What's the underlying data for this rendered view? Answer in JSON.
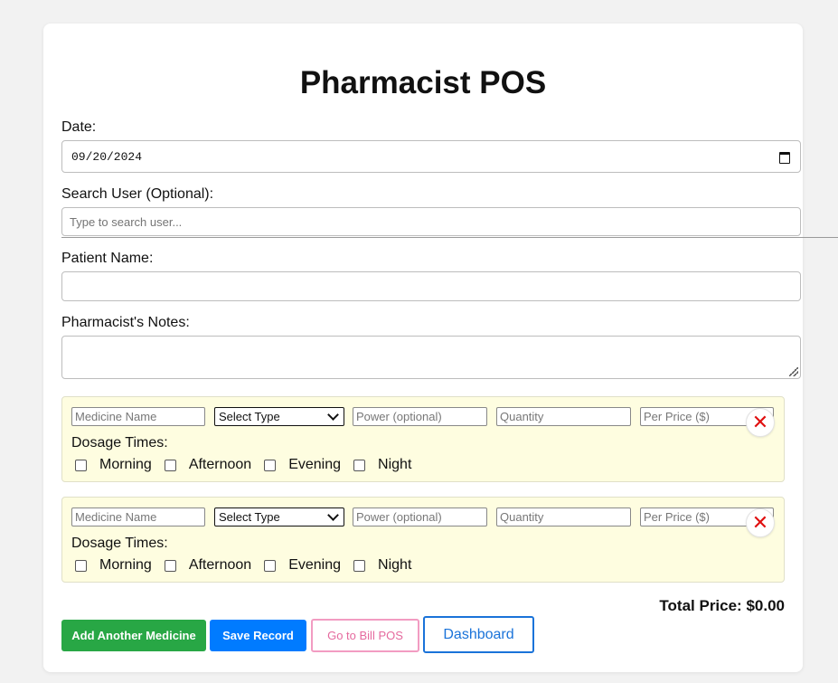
{
  "app": {
    "title": "Pharmacist POS"
  },
  "form": {
    "date_label": "Date:",
    "date_value": "09/20/2024",
    "search_label": "Search User (Optional):",
    "search_placeholder": "Type to search user...",
    "patient_label": "Patient Name:",
    "patient_value": "",
    "notes_label": "Pharmacist's Notes:",
    "notes_value": ""
  },
  "medicines": [
    {
      "name_placeholder": "Medicine Name",
      "type_selected": "Select Type",
      "power_placeholder": "Power (optional)",
      "quantity_placeholder": "Quantity",
      "price_placeholder": "Per Price ($)",
      "remove_glyph": "✕",
      "dosage_label": "Dosage Times:",
      "times": [
        "Morning",
        "Afternoon",
        "Evening",
        "Night"
      ]
    },
    {
      "name_placeholder": "Medicine Name",
      "type_selected": "Select Type",
      "power_placeholder": "Power (optional)",
      "quantity_placeholder": "Quantity",
      "price_placeholder": "Per Price ($)",
      "remove_glyph": "✕",
      "dosage_label": "Dosage Times:",
      "times": [
        "Morning",
        "Afternoon",
        "Evening",
        "Night"
      ]
    }
  ],
  "summary": {
    "total_label": "Total Price: $0.00"
  },
  "actions": {
    "add_medicine": "Add Another Medicine",
    "save_record": "Save Record",
    "go_to_bill": "Go to Bill POS",
    "dashboard": "Dashboard"
  },
  "colors": {
    "add_button": "#28a745",
    "save_button": "#007bff",
    "bill_button_border": "#f29cc2",
    "dashboard_button": "#1a73d9",
    "medicine_block": "#fefde0",
    "remove_icon": "#e01010"
  },
  "icons": {
    "date_picker": "calendar-icon",
    "remove": "close-icon",
    "select": "chevron-down-icon"
  }
}
